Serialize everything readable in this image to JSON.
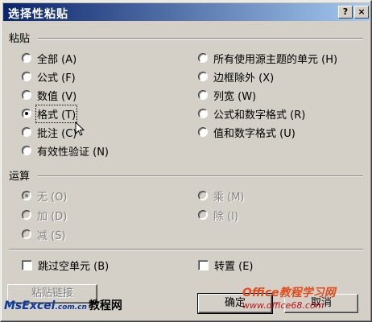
{
  "dialog": {
    "title": "选择性粘贴",
    "help_button": "?",
    "close_button": "×"
  },
  "paste_group": {
    "label": "粘贴",
    "left_options": [
      {
        "label": "全部 (A)",
        "checked": false
      },
      {
        "label": "公式 (F)",
        "checked": false
      },
      {
        "label": "数值 (V)",
        "checked": false
      },
      {
        "label": "格式 (T)",
        "checked": true
      },
      {
        "label": "批注 (C)",
        "checked": false
      },
      {
        "label": "有效性验证 (N)",
        "checked": false
      }
    ],
    "right_options": [
      {
        "label": "所有使用源主题的单元 (H)",
        "checked": false
      },
      {
        "label": "边框除外 (X)",
        "checked": false
      },
      {
        "label": "列宽 (W)",
        "checked": false
      },
      {
        "label": "公式和数字格式 (R)",
        "checked": false
      },
      {
        "label": "值和数字格式 (U)",
        "checked": false
      }
    ]
  },
  "operation_group": {
    "label": "运算",
    "left_options": [
      {
        "label": "无 (O)",
        "checked": true
      },
      {
        "label": "加 (D)",
        "checked": false
      },
      {
        "label": "减 (S)",
        "checked": false
      }
    ],
    "right_options": [
      {
        "label": "乘 (M)",
        "checked": false
      },
      {
        "label": "除 (I)",
        "checked": false
      }
    ]
  },
  "checkboxes": {
    "skip_blanks": "跳过空单元 (B)",
    "transpose": "转置 (E)"
  },
  "buttons": {
    "paste_link": "粘贴链接",
    "ok": "确定",
    "cancel": "取消"
  },
  "watermarks": {
    "left_brand": "MsExcel",
    "left_domain": ".com.cn",
    "left_text": "教程网",
    "right_line1": "Office教程学习网",
    "right_line2": "www.office68.com"
  }
}
